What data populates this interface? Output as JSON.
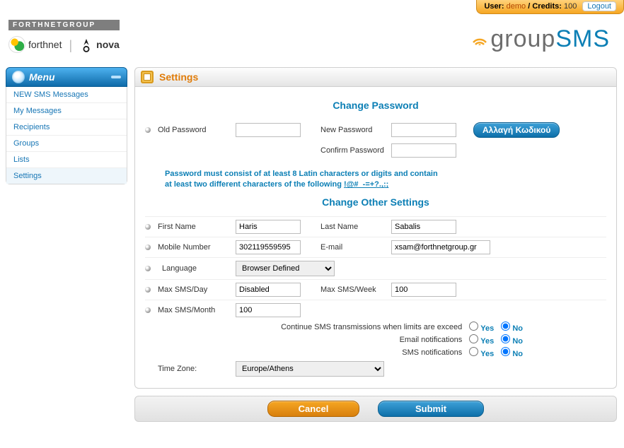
{
  "colors": {
    "accent_blue": "#0c7fb5",
    "accent_orange": "#e07c0a"
  },
  "userbar": {
    "user_label": "User:",
    "username": "demo",
    "credits_label": "/ Credits:",
    "credits_value": "100",
    "logout": "Logout"
  },
  "logos": {
    "forthnetgroup": "FORTHNETGROUP",
    "forthnet": "forthnet",
    "nova": "nova",
    "group": "group",
    "sms": "SMS"
  },
  "menu": {
    "header": "Menu",
    "items": [
      {
        "label": "NEW SMS Messages",
        "active": false
      },
      {
        "label": "My Messages",
        "active": false
      },
      {
        "label": "Recipients",
        "active": false
      },
      {
        "label": "Groups",
        "active": false
      },
      {
        "label": "Lists",
        "active": false
      },
      {
        "label": "Settings",
        "active": true
      }
    ]
  },
  "page": {
    "title": "Settings"
  },
  "password_section": {
    "heading": "Change Password",
    "labels": {
      "old": "Old Password",
      "new": "New Password",
      "confirm": "Confirm Password"
    },
    "values": {
      "old": "",
      "new": "",
      "confirm": ""
    },
    "button": "Αλλαγή Κωδικού",
    "hint_line1": "Password must consist of at least 8 Latin characters or digits and contain",
    "hint_line2_prefix": "at least two different characters of the following ",
    "hint_symbols": "!@#_-=+?.,:;"
  },
  "other_section": {
    "heading": "Change Other Settings",
    "labels": {
      "first_name": "First Name",
      "last_name": "Last Name",
      "mobile": "Mobile Number",
      "email": "E-mail",
      "language": "Language",
      "max_day": "Max SMS/Day",
      "max_week": "Max SMS/Week",
      "max_month": "Max SMS/Month",
      "continue": "Continue SMS transmissions when limits are exceed",
      "email_notif": "Email notifications",
      "sms_notif": "SMS notifications",
      "timezone": "Time Zone:",
      "yes": "Yes",
      "no": "No"
    },
    "values": {
      "first_name": "Haris",
      "last_name": "Sabalis",
      "mobile": "302119559595",
      "email": "xsam@forthnetgroup.gr",
      "language": "Browser Defined",
      "max_day": "Disabled",
      "max_week": "100",
      "max_month": "100",
      "continue": "No",
      "email_notif": "No",
      "sms_notif": "No",
      "timezone": "Europe/Athens"
    }
  },
  "actions": {
    "cancel": "Cancel",
    "submit": "Submit"
  }
}
